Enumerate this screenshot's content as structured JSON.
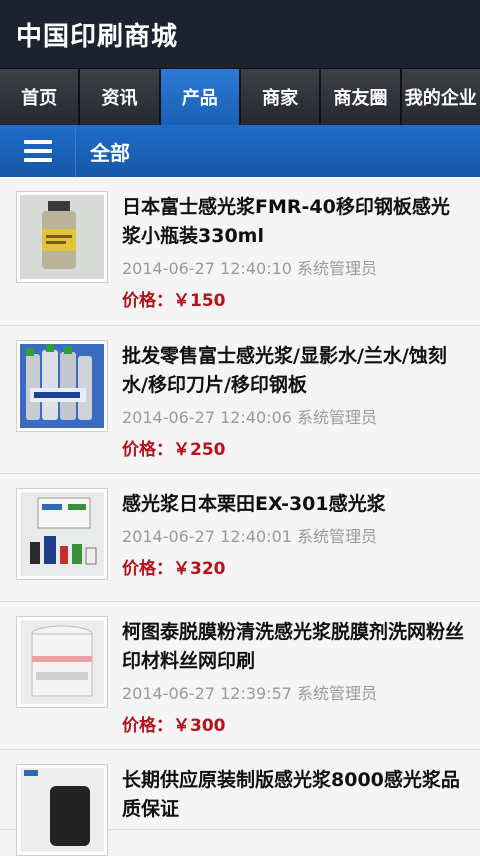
{
  "header": {
    "title": "中国印刷商城"
  },
  "nav": {
    "tabs": [
      {
        "label": "首页",
        "active": false
      },
      {
        "label": "资讯",
        "active": false
      },
      {
        "label": "产品",
        "active": true
      },
      {
        "label": "商家",
        "active": false
      },
      {
        "label": "商友圈",
        "active": false
      },
      {
        "label": "我的企业",
        "active": false
      }
    ]
  },
  "subbar": {
    "label": "全部",
    "menu_icon": "hamburger-menu-icon"
  },
  "products": [
    {
      "name": "日本富士感光浆FMR-40移印钢板感光浆小瓶装330ml",
      "datetime": "2014-06-27 12:40:10",
      "author": "系统管理员",
      "price": "价格：￥150"
    },
    {
      "name": "批发零售富士感光浆/显影水/兰水/蚀刻水/移印刀片/移印钢板",
      "datetime": "2014-06-27 12:40:06",
      "author": "系统管理员",
      "price": "价格：￥250"
    },
    {
      "name": "感光浆日本栗田EX-301感光浆",
      "datetime": "2014-06-27 12:40:01",
      "author": "系统管理员",
      "price": "价格：￥320"
    },
    {
      "name": "柯图泰脱膜粉清洗感光浆脱膜剂洗网粉丝印材料丝网印刷",
      "datetime": "2014-06-27 12:39:57",
      "author": "系统管理员",
      "price": "价格：￥300"
    },
    {
      "name": "长期供应原装制版感光浆8000感光浆品质保证",
      "datetime": "",
      "author": "",
      "price": ""
    }
  ]
}
